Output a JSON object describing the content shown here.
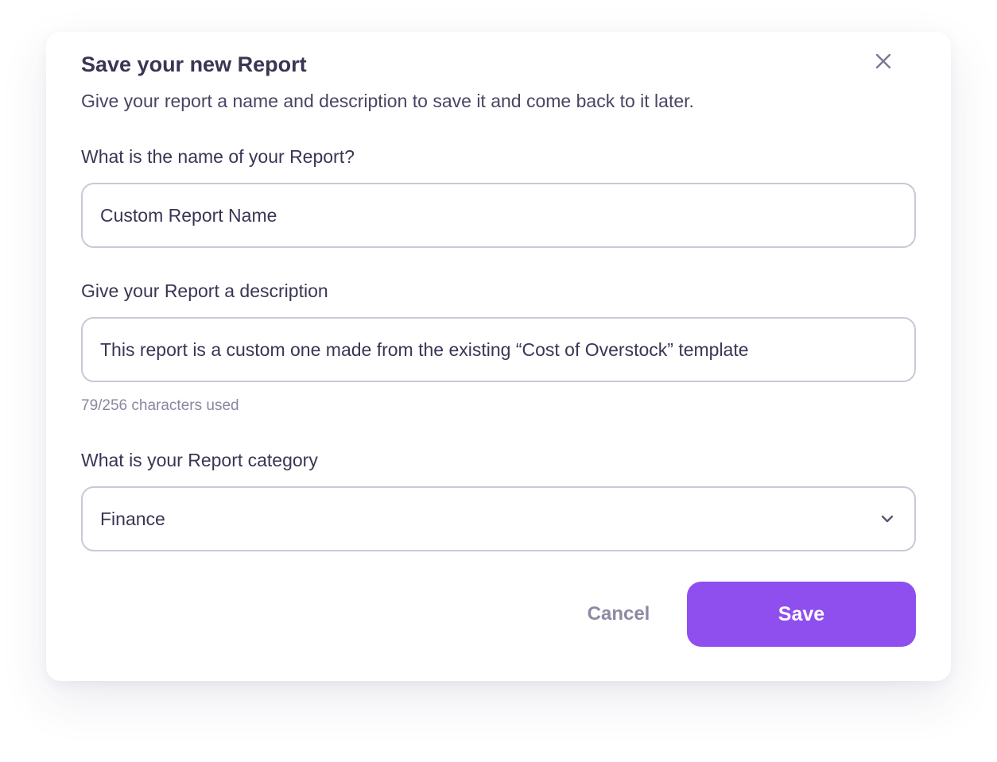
{
  "dialog": {
    "title": "Save your new Report",
    "subtitle": "Give your report a name and description to save it and come back to it later.",
    "close_icon": "close-icon"
  },
  "name_field": {
    "label": "What is the name of your Report?",
    "value": "Custom Report Name"
  },
  "description_field": {
    "label": "Give your Report a description",
    "value": "This report is a custom one made from the existing “Cost of Overstock” template",
    "char_count": "79/256 characters used"
  },
  "category_field": {
    "label": "What is your Report category",
    "selected": "Finance",
    "icon": "chevron-down-icon"
  },
  "actions": {
    "cancel_label": "Cancel",
    "save_label": "Save"
  },
  "colors": {
    "primary": "#8e4fee",
    "text": "#3b3554",
    "muted": "#8a86a0",
    "border": "#cbc8d6"
  }
}
